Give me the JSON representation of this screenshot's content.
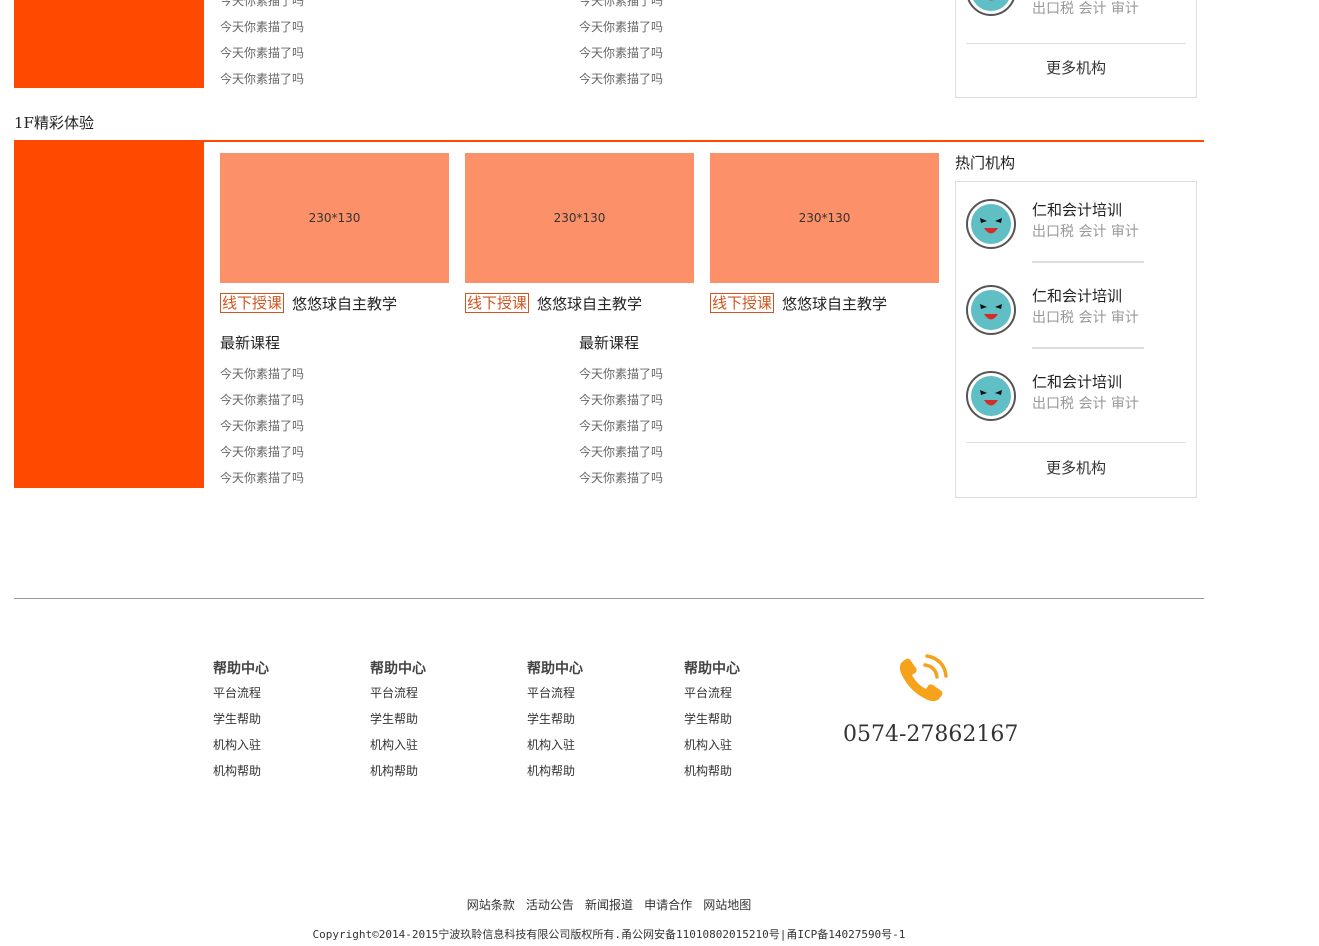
{
  "top_section": {
    "list_a": [
      "今天你素描了吗",
      "今天你素描了吗",
      "今天你素描了吗",
      "今天你素描了吗"
    ],
    "list_b": [
      "今天你素描了吗",
      "今天你素描了吗",
      "今天你素描了吗",
      "今天你素描了吗"
    ],
    "institution_tags": "出口税  会计  审计",
    "more_label": "更多机构"
  },
  "floor1": {
    "title": "1F精彩体验",
    "courses": [
      {
        "thumb": "230*130",
        "tag": "线下授课",
        "title": "悠悠球自主教学"
      },
      {
        "thumb": "230*130",
        "tag": "线下授课",
        "title": "悠悠球自主教学"
      },
      {
        "thumb": "230*130",
        "tag": "线下授课",
        "title": "悠悠球自主教学"
      }
    ],
    "latest_a": {
      "heading": "最新课程",
      "items": [
        "今天你素描了吗",
        "今天你素描了吗",
        "今天你素描了吗",
        "今天你素描了吗",
        "今天你素描了吗"
      ]
    },
    "latest_b": {
      "heading": "最新课程",
      "items": [
        "今天你素描了吗",
        "今天你素描了吗",
        "今天你素描了吗",
        "今天你素描了吗",
        "今天你素描了吗"
      ]
    },
    "hot": {
      "heading": "热门机构",
      "items": [
        {
          "name": "仁和会计培训",
          "tags": "出口税  会计  审计"
        },
        {
          "name": "仁和会计培训",
          "tags": "出口税  会计  审计"
        },
        {
          "name": "仁和会计培训",
          "tags": "出口税  会计  审计"
        }
      ],
      "more_label": "更多机构"
    }
  },
  "footer": {
    "columns": [
      {
        "heading": "帮助中心",
        "links": [
          "平台流程",
          "学生帮助",
          "机构入驻",
          "机构帮助"
        ]
      },
      {
        "heading": "帮助中心",
        "links": [
          "平台流程",
          "学生帮助",
          "机构入驻",
          "机构帮助"
        ]
      },
      {
        "heading": "帮助中心",
        "links": [
          "平台流程",
          "学生帮助",
          "机构入驻",
          "机构帮助"
        ]
      },
      {
        "heading": "帮助中心",
        "links": [
          "平台流程",
          "学生帮助",
          "机构入驻",
          "机构帮助"
        ]
      }
    ],
    "phone": "0574-27862167",
    "bottom_links": [
      "网站条款",
      "活动公告",
      "新闻报道",
      "申请合作",
      "网站地图"
    ],
    "copyright": "Copyright©2014-2015宁波玖聆信息科技有限公司版权所有.甬公网安备11010802015210号|甬ICP备14027590号-1"
  },
  "icons": {
    "avatar": "blue-cartoon-face-icon",
    "phone": "phone-ringing-icon"
  },
  "colors": {
    "accent": "#ff4800",
    "thumb": "#fb9069",
    "tag": "#d2541f",
    "phone_icon": "#f7a21b"
  }
}
